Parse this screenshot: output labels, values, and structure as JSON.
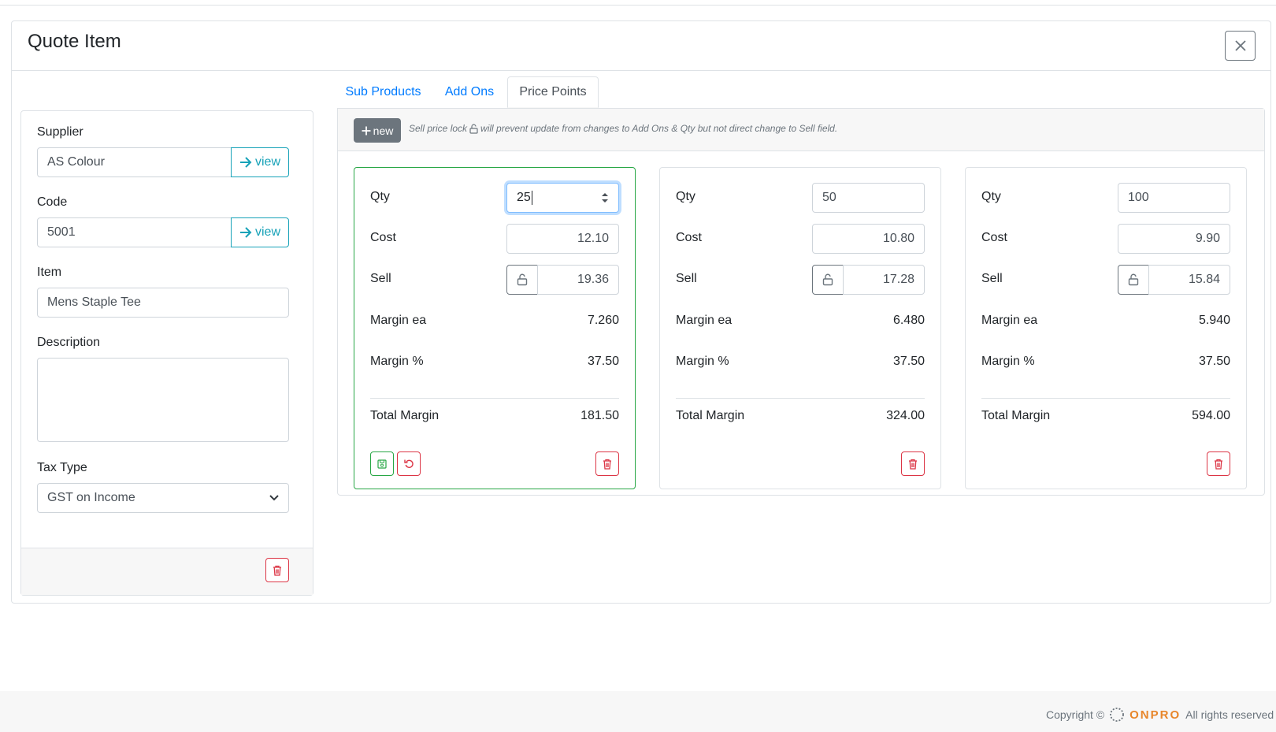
{
  "modal": {
    "title": "Quote Item",
    "close_icon": "close-icon"
  },
  "left": {
    "supplier_label": "Supplier",
    "supplier_value": "AS Colour",
    "code_label": "Code",
    "code_value": "5001",
    "view_label": "view",
    "item_label": "Item",
    "item_value": "Mens Staple Tee",
    "description_label": "Description",
    "description_value": "",
    "tax_label": "Tax Type",
    "tax_value": "GST on Income"
  },
  "tabs": [
    {
      "label": "Sub Products",
      "active": false
    },
    {
      "label": "Add Ons",
      "active": false
    },
    {
      "label": "Price Points",
      "active": true
    }
  ],
  "toolbar": {
    "new_label": "new",
    "hint_before": "Sell price lock",
    "hint_after": "will prevent update from changes to Add Ons & Qty but not direct change to Sell field."
  },
  "labels": {
    "qty": "Qty",
    "cost": "Cost",
    "sell": "Sell",
    "margin_ea": "Margin ea",
    "margin_pct": "Margin %",
    "total_margin": "Total Margin"
  },
  "price_points": [
    {
      "qty": "25",
      "cost": "12.10",
      "sell": "19.36",
      "margin_ea": "7.260",
      "margin_pct": "37.50",
      "total_margin": "181.50",
      "editing": true
    },
    {
      "qty": "50",
      "cost": "10.80",
      "sell": "17.28",
      "margin_ea": "6.480",
      "margin_pct": "37.50",
      "total_margin": "324.00",
      "editing": false
    },
    {
      "qty": "100",
      "cost": "9.90",
      "sell": "15.84",
      "margin_ea": "5.940",
      "margin_pct": "37.50",
      "total_margin": "594.00",
      "editing": false
    }
  ],
  "colors": {
    "primary": "#007bff",
    "info": "#17a2b8",
    "success": "#28a745",
    "danger": "#dc3545",
    "secondary": "#6c757d",
    "brand": "#e8862a"
  },
  "footer": {
    "copyright": "Copyright ©",
    "brand": "ONPRO",
    "rights": "All rights reserved"
  }
}
